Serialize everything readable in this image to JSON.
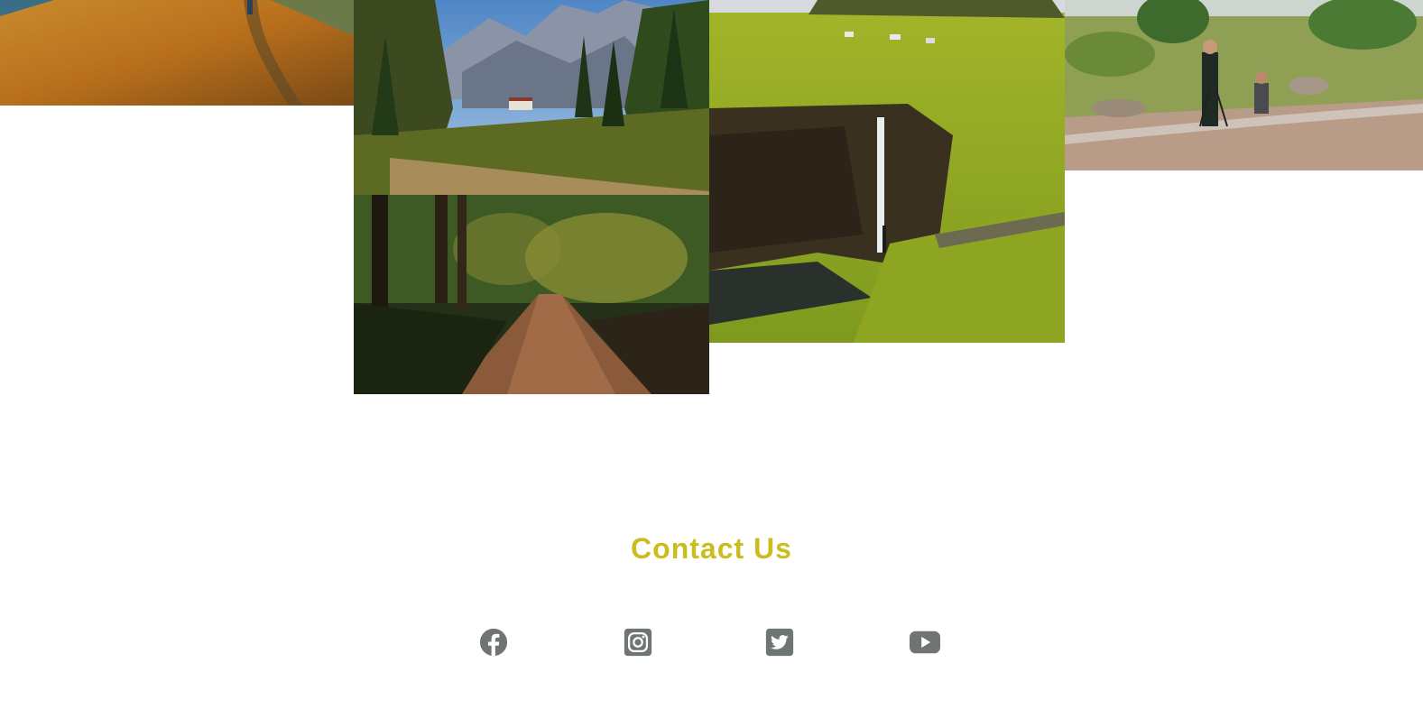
{
  "gallery": {
    "photos": [
      {
        "subject": "golden-hill-trail-photo"
      },
      {
        "subject": "alpine-valley-photo"
      },
      {
        "subject": "forest-path-photo"
      },
      {
        "subject": "waterfall-cliff-photo"
      },
      {
        "subject": "photographers-field-photo"
      }
    ]
  },
  "contact": {
    "title": "Contact Us",
    "title_color": "#cbbd1f"
  },
  "socials": {
    "icon_color": "#6f7672",
    "items": [
      {
        "icon": "facebook-icon"
      },
      {
        "icon": "instagram-icon"
      },
      {
        "icon": "twitter-icon"
      },
      {
        "icon": "youtube-icon"
      }
    ]
  }
}
